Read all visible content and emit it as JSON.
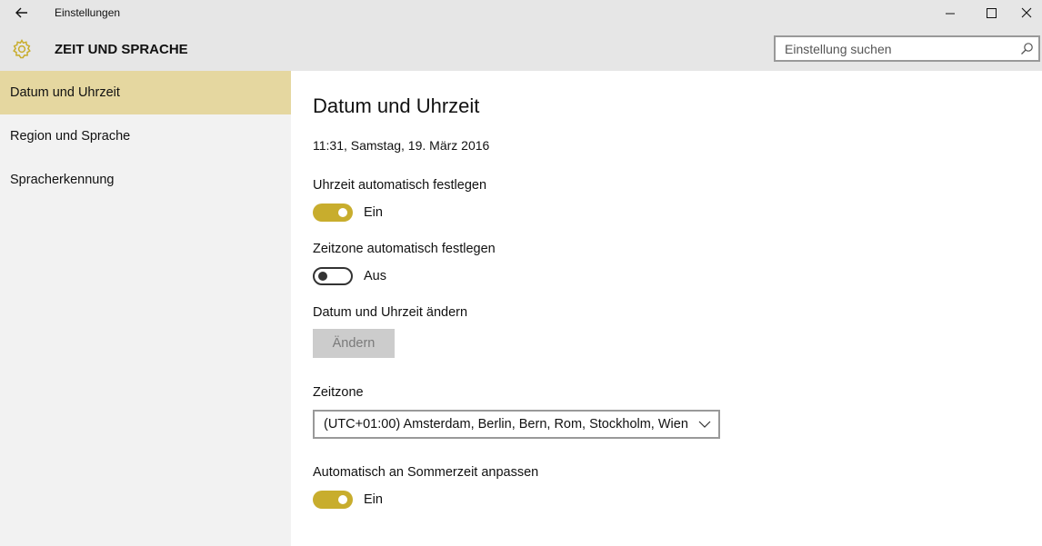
{
  "window": {
    "title": "Einstellungen",
    "section": "ZEIT UND SPRACHE"
  },
  "search": {
    "placeholder": "Einstellung suchen"
  },
  "sidebar": {
    "items": [
      {
        "label": "Datum und Uhrzeit",
        "active": true
      },
      {
        "label": "Region und Sprache",
        "active": false
      },
      {
        "label": "Spracherkennung",
        "active": false
      }
    ]
  },
  "main": {
    "title": "Datum und Uhrzeit",
    "current_datetime": "11:31, Samstag, 19. März 2016",
    "auto_time": {
      "label": "Uhrzeit automatisch festlegen",
      "state": "Ein"
    },
    "auto_timezone": {
      "label": "Zeitzone automatisch festlegen",
      "state": "Aus"
    },
    "change": {
      "label": "Datum und Uhrzeit ändern",
      "button": "Ändern"
    },
    "timezone": {
      "label": "Zeitzone",
      "value": "(UTC+01:00) Amsterdam, Berlin, Bern, Rom, Stockholm, Wien"
    },
    "dst": {
      "label": "Automatisch an Sommerzeit anpassen",
      "state": "Ein"
    }
  },
  "colors": {
    "accent": "#c8ad2d",
    "sidebar_selected": "#e5d7a0",
    "titlebar": "#e6e6e6",
    "sidebar": "#f2f2f2"
  },
  "icons": [
    "back-arrow-icon",
    "gear-icon",
    "search-icon",
    "minimize-icon",
    "maximize-icon",
    "close-icon",
    "chevron-down-icon"
  ]
}
